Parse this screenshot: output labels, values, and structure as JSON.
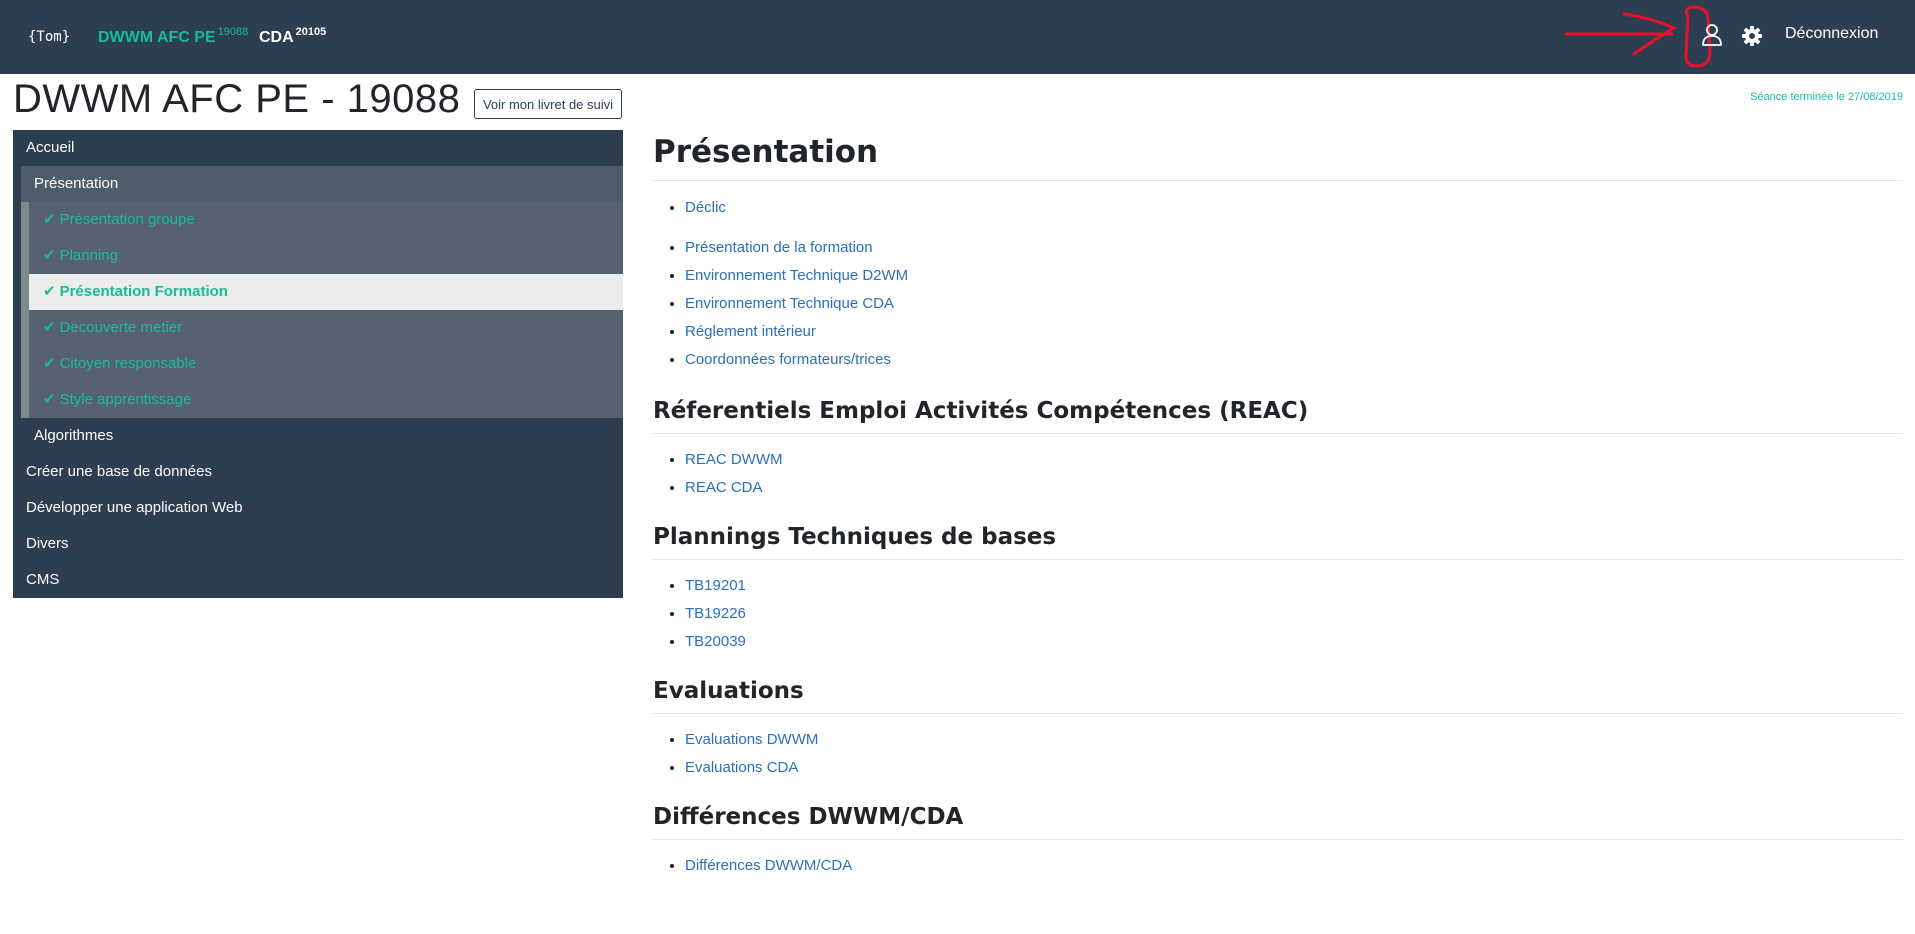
{
  "navbar": {
    "brand": "{Tom}",
    "dwwm_label": "DWWM AFC PE",
    "dwwm_sup": "19088",
    "cda_label": "CDA",
    "cda_sup": "20105",
    "logout_label": "Déconnexion",
    "user_icon": "user-icon",
    "gear_icon": "gear-icon"
  },
  "header": {
    "title": "DWWM AFC PE - 19088",
    "livret_button": "Voir mon livret de suivi",
    "status": "Séance terminée le 27/08/2019"
  },
  "sidebar": {
    "accueil": "Accueil",
    "presentation": "Présentation",
    "sub_items": [
      "Présentation groupe",
      "Planning",
      "Présentation Formation",
      "Decouverte metier",
      "Citoyen responsable",
      "Style apprentissage"
    ],
    "algorithmes": "Algorithmes",
    "bottom_items": [
      "Créer une base de données",
      "Développer une application Web",
      "Divers",
      "CMS"
    ]
  },
  "main": {
    "title": "Présentation",
    "intro_links": [
      "Déclic"
    ],
    "formation_links": [
      "Présentation de la formation",
      "Environnement Technique D2WM",
      "Environnement Technique CDA",
      "Réglement intérieur",
      "Coordonnées formateurs/trices"
    ],
    "sections": [
      {
        "title": "Réferentiels Emploi Activités Compétences (REAC)",
        "links": [
          "REAC DWWM",
          "REAC CDA"
        ]
      },
      {
        "title": "Plannings Techniques de bases",
        "links": [
          "TB19201",
          "TB19226",
          "TB20039"
        ]
      },
      {
        "title": "Evaluations",
        "links": [
          "Evaluations DWWM",
          "Evaluations CDA"
        ]
      },
      {
        "title": "Différences DWWM/CDA",
        "links": [
          "Différences DWWM/CDA"
        ]
      }
    ]
  },
  "colors": {
    "navbar": "#2c3e50",
    "accent": "#18bc9c",
    "link": "#2c6fbb",
    "annotation": "#e8112d"
  }
}
